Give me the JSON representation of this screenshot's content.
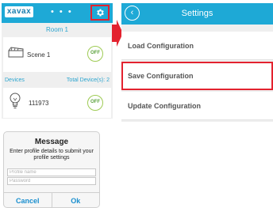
{
  "home": {
    "logo": "xavax",
    "dots": "• • •",
    "room_title": "Room 1",
    "scene_label": "Scene 1",
    "scene_switch": "OFF",
    "devices_label": "Devices",
    "devices_total": "Total Device(s): 2",
    "device_label": "111973",
    "device_switch": "OFF"
  },
  "settings": {
    "back_icon": "‹",
    "title": "Settings",
    "items": [
      {
        "label": "Load Configuration"
      },
      {
        "label": "Save Configuration"
      },
      {
        "label": "Update Configuration"
      }
    ]
  },
  "dialog": {
    "title": "Message",
    "message": "Enter profile details to submit your profile settings",
    "profile_placeholder": "Profile name",
    "password_placeholder": "Password",
    "cancel_label": "Cancel",
    "ok_label": "Ok"
  },
  "colors": {
    "header_blue": "#1ea9d6",
    "highlight_red": "#e3222f",
    "switch_green": "#9ecb54"
  }
}
